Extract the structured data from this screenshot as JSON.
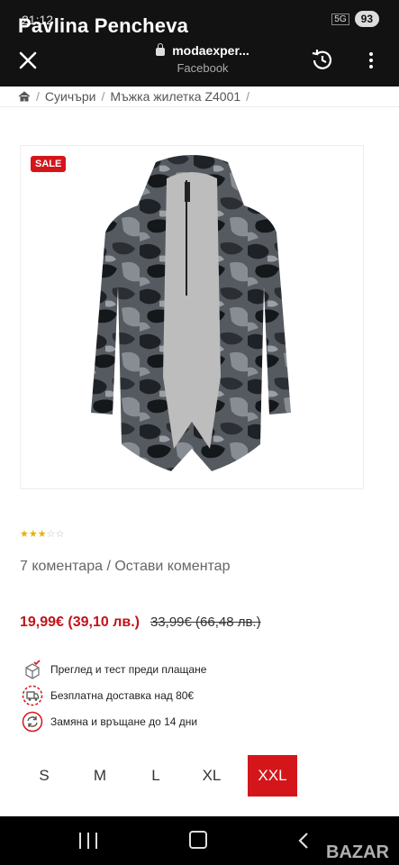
{
  "status": {
    "time": "21:12",
    "signal": "5G",
    "battery": "93"
  },
  "overlay_name": "Pavlina Pencheva",
  "browser": {
    "url": "modaexper...",
    "source": "Facebook"
  },
  "breadcrumb": {
    "items": [
      "Суичъри",
      "Мъжка жилетка Z4001"
    ]
  },
  "product": {
    "sale_badge": "SALE",
    "rating_stars": {
      "filled": 3,
      "total": 5
    },
    "comments": "7 коментара",
    "comments_sep": " / ",
    "leave_comment": "Остави коментар",
    "price_now": "19,99€ (39,10 лв.)",
    "price_old": "33,99€ (66,48 лв.)"
  },
  "features": [
    {
      "icon": "box-check-icon",
      "text": "Преглед и тест преди плащане"
    },
    {
      "icon": "delivery-truck-icon",
      "text": "Безплатна доставка над 80€"
    },
    {
      "icon": "exchange-arrows-icon",
      "text": "Замяна и връщане до 14 дни"
    }
  ],
  "sizes": [
    "S",
    "M",
    "L",
    "XL",
    "XXL"
  ],
  "selected_size": "XXL",
  "watermark": "BAZAR",
  "colors": {
    "accent": "#d4161b",
    "price": "#c0141a",
    "star": "#e8b100"
  }
}
